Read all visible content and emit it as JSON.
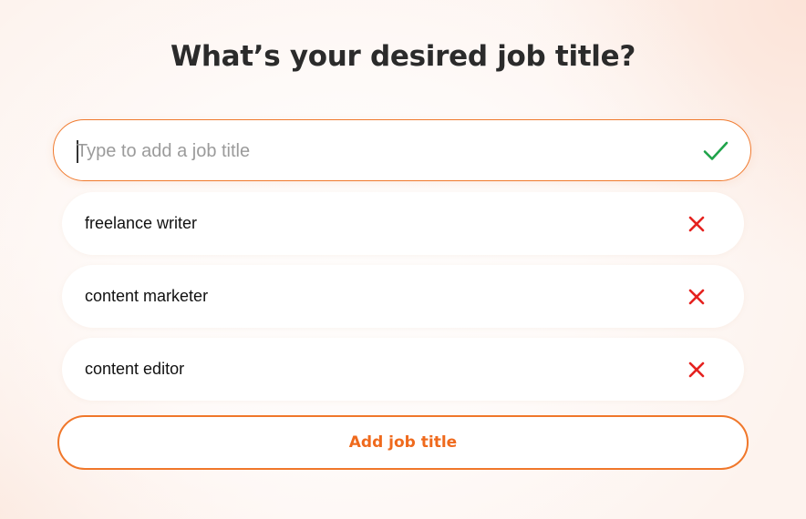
{
  "header": {
    "title": "What’s your desired job title?"
  },
  "search": {
    "placeholder": "Type to add a job title",
    "value": "",
    "confirm_icon": "check-icon",
    "confirm_color": "#1fa34a"
  },
  "job_titles": [
    {
      "label": "freelance writer",
      "remove_icon": "close-icon"
    },
    {
      "label": "content marketer",
      "remove_icon": "close-icon"
    },
    {
      "label": "content editor",
      "remove_icon": "close-icon"
    }
  ],
  "actions": {
    "add_label": "Add job title"
  },
  "colors": {
    "accent": "#f0772a",
    "remove": "#e5221f",
    "title": "#2b2b2b"
  }
}
